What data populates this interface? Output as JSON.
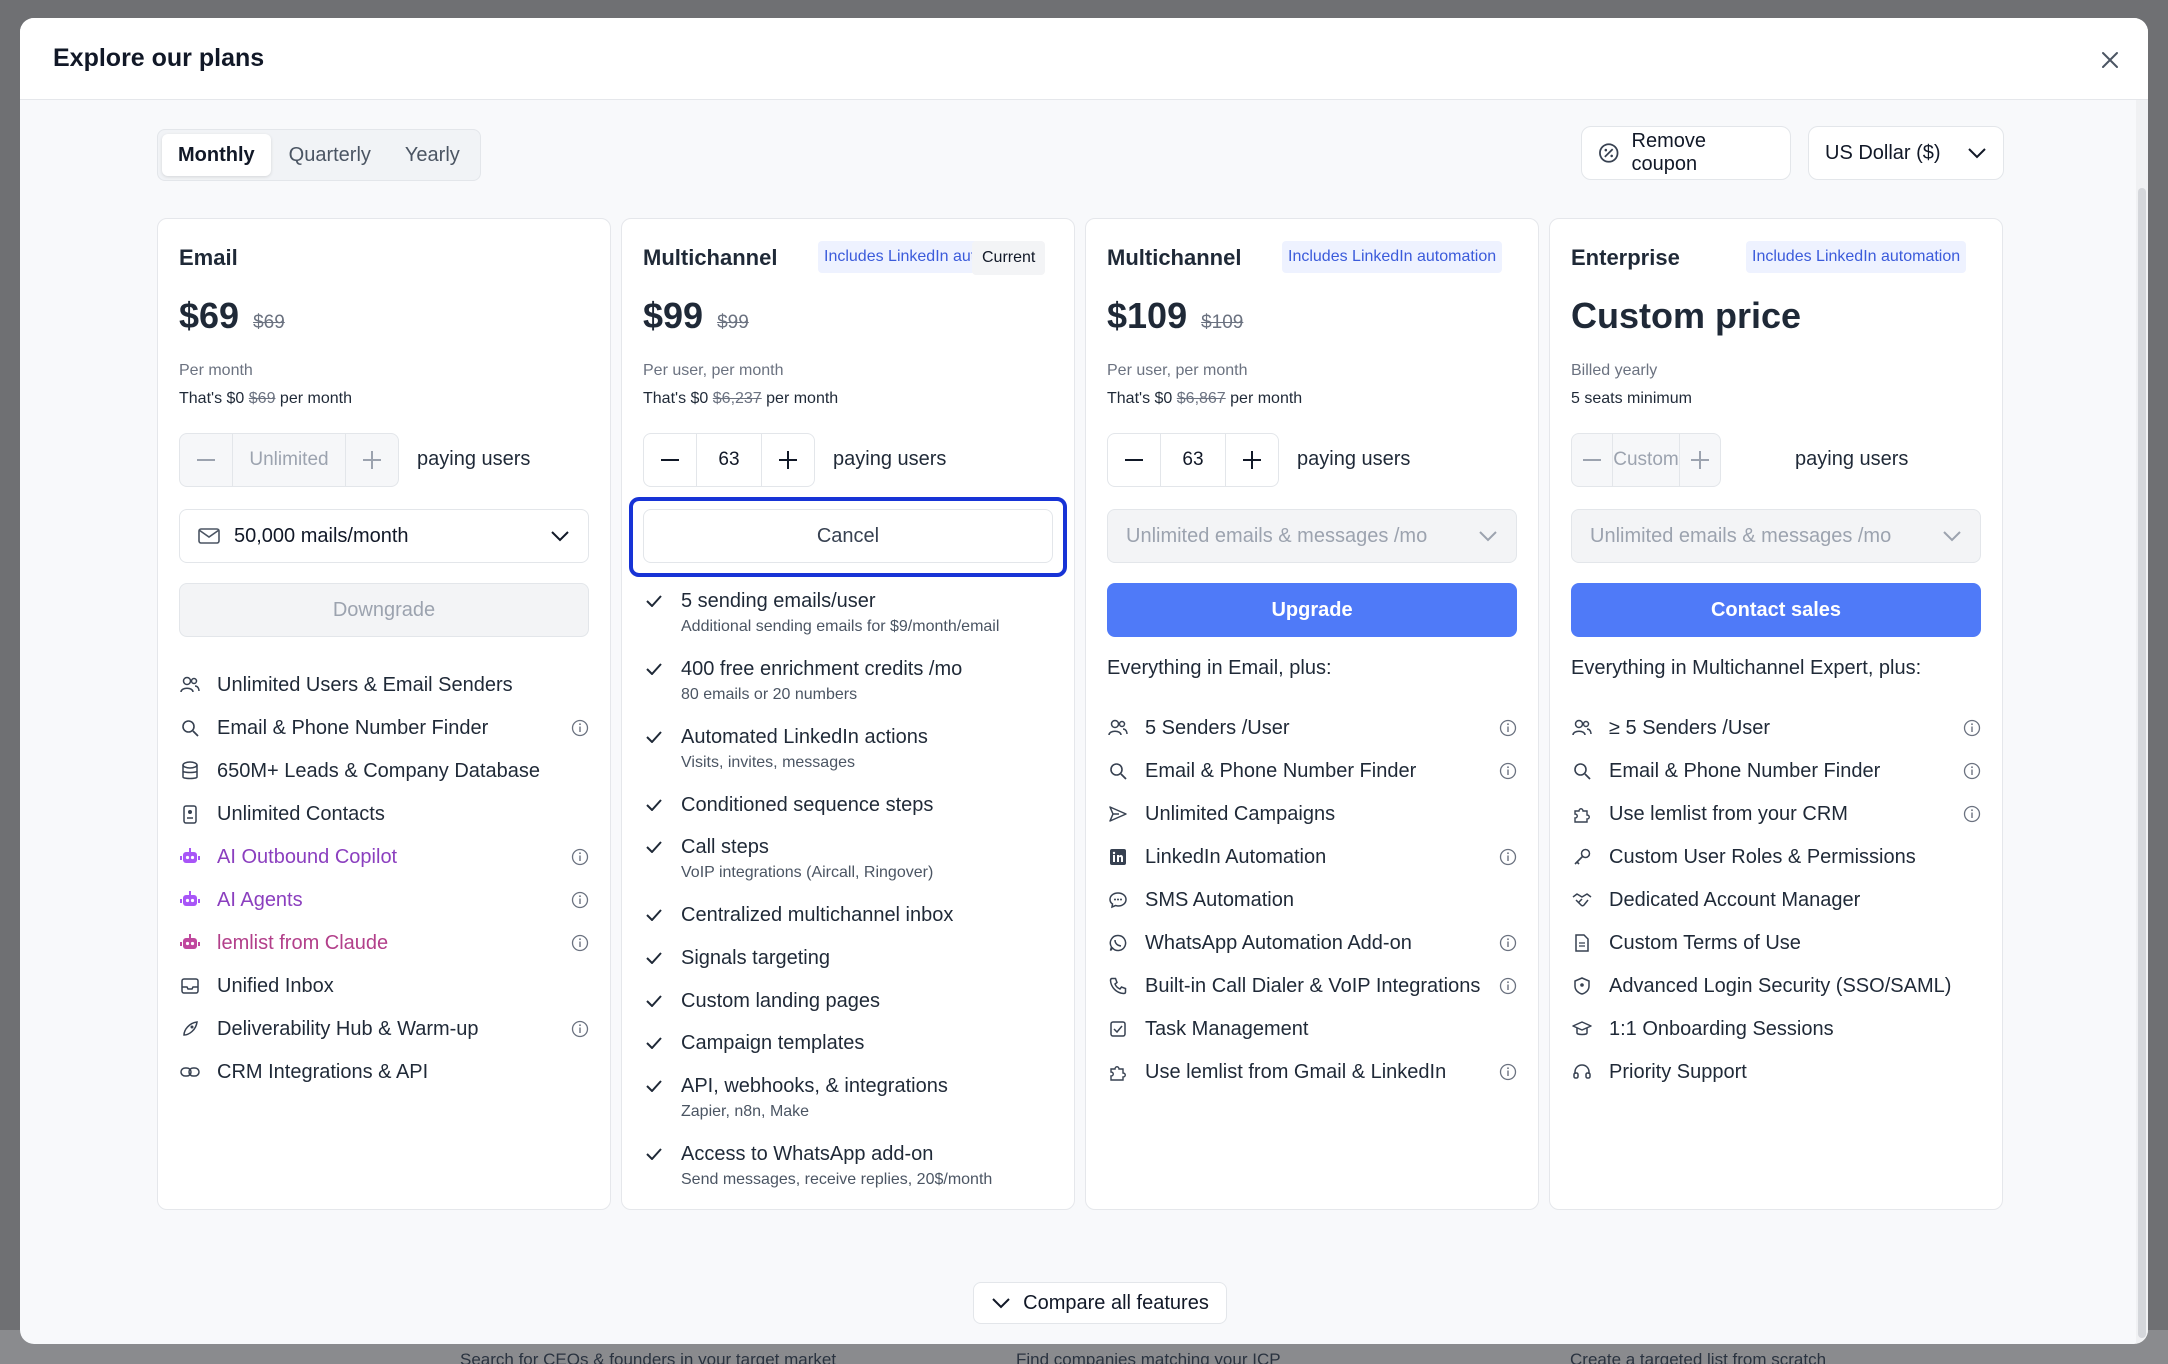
{
  "modal": {
    "title": "Explore our plans"
  },
  "period": {
    "options": [
      "Monthly",
      "Quarterly",
      "Yearly"
    ],
    "selected": "Monthly"
  },
  "coupon": {
    "label": "Remove coupon"
  },
  "currency": {
    "value": "US Dollar ($)"
  },
  "plans": [
    {
      "name": "Email",
      "price": "$69",
      "old_price": "$69",
      "sub1": "Per month",
      "sub2_prefix": "That's $0",
      "sub2_old": "$69",
      "sub2_suffix": "per month",
      "users": "Unlimited",
      "users_label": "paying users",
      "mails": "50,000 mails/month",
      "action": "Downgrade",
      "features": [
        {
          "icon": "users-icon",
          "label": "Unlimited Users & Email Senders",
          "info": false
        },
        {
          "icon": "search-icon",
          "label": "Email & Phone Number Finder",
          "info": true
        },
        {
          "icon": "database-icon",
          "label": "650M+ Leads & Company Database",
          "info": false
        },
        {
          "icon": "contact-icon",
          "label": "Unlimited Contacts",
          "info": false
        },
        {
          "icon": "ai-robot-icon",
          "label": "AI Outbound Copilot",
          "info": true
        },
        {
          "icon": "ai-robot-icon",
          "label": "AI Agents",
          "info": true
        },
        {
          "icon": "ai-robot-icon",
          "label": "lemlist from Claude",
          "info": true
        },
        {
          "icon": "inbox-icon",
          "label": "Unified Inbox",
          "info": false
        },
        {
          "icon": "rocket-icon",
          "label": "Deliverability Hub & Warm-up",
          "info": true
        },
        {
          "icon": "link-icon",
          "label": "CRM Integrations & API",
          "info": false
        }
      ]
    },
    {
      "name": "Multichannel",
      "badge": "Includes LinkedIn automation",
      "current": "Current",
      "price": "$99",
      "old_price": "$99",
      "sub1": "Per user, per month",
      "sub2_prefix": "That's $0",
      "sub2_old": "$6,237",
      "sub2_suffix": "per month",
      "users": "63",
      "users_label": "paying users",
      "action": "Cancel",
      "checks": [
        {
          "label": "5 sending emails/user",
          "desc": "Additional sending emails for $9/month/email"
        },
        {
          "label": "400 free enrichment credits /mo",
          "desc": "80 emails or 20 numbers"
        },
        {
          "label": "Automated LinkedIn actions",
          "desc": "Visits, invites, messages"
        },
        {
          "label": "Conditioned sequence steps",
          "desc": ""
        },
        {
          "label": "Call steps",
          "desc": "VoIP integrations (Aircall, Ringover)"
        },
        {
          "label": "Centralized multichannel inbox",
          "desc": ""
        },
        {
          "label": "Signals targeting",
          "desc": ""
        },
        {
          "label": "Custom landing pages",
          "desc": ""
        },
        {
          "label": "Campaign templates",
          "desc": ""
        },
        {
          "label": "API, webhooks, & integrations",
          "desc": "Zapier, n8n, Make"
        },
        {
          "label": "Access to WhatsApp add-on",
          "desc": "Send messages, receive replies, 20$/month"
        }
      ]
    },
    {
      "name": "Multichannel",
      "badge": "Includes LinkedIn automation",
      "price": "$109",
      "old_price": "$109",
      "sub1": "Per user, per month",
      "sub2_prefix": "That's $0",
      "sub2_old": "$6,867",
      "sub2_suffix": "per month",
      "users": "63",
      "users_label": "paying users",
      "mails": "Unlimited emails & messages /mo",
      "action": "Upgrade",
      "section_title": "Everything in Email, plus:",
      "features": [
        {
          "icon": "users-icon",
          "label": "5 Senders /User",
          "info": true
        },
        {
          "icon": "search-icon",
          "label": "Email & Phone Number Finder",
          "info": true
        },
        {
          "icon": "send-icon",
          "label": "Unlimited Campaigns",
          "info": false
        },
        {
          "icon": "linkedin-icon",
          "label": "LinkedIn Automation",
          "info": true
        },
        {
          "icon": "sms-icon",
          "label": "SMS Automation",
          "info": false
        },
        {
          "icon": "whatsapp-icon",
          "label": "WhatsApp Automation Add-on",
          "info": true
        },
        {
          "icon": "phone-icon",
          "label": "Built-in Call Dialer & VoIP Integrations",
          "info": true
        },
        {
          "icon": "task-icon",
          "label": "Task Management",
          "info": false
        },
        {
          "icon": "puzzle-icon",
          "label": "Use lemlist from Gmail & LinkedIn",
          "info": true
        }
      ]
    },
    {
      "name": "Enterprise",
      "badge": "Includes LinkedIn automation",
      "price": "Custom price",
      "sub1": "Billed yearly",
      "sub2": "5 seats minimum",
      "users": "Custom",
      "users_label": "paying users",
      "mails": "Unlimited emails & messages /mo",
      "action": "Contact sales",
      "section_title": "Everything in Multichannel Expert, plus:",
      "features": [
        {
          "icon": "users-icon",
          "label": "≥ 5 Senders /User",
          "info": true
        },
        {
          "icon": "search-icon",
          "label": "Email & Phone Number Finder",
          "info": true
        },
        {
          "icon": "puzzle-icon",
          "label": "Use lemlist from your CRM",
          "info": true
        },
        {
          "icon": "key-icon",
          "label": "Custom User Roles & Permissions",
          "info": false
        },
        {
          "icon": "handshake-icon",
          "label": "Dedicated Account Manager",
          "info": false
        },
        {
          "icon": "document-icon",
          "label": "Custom Terms of Use",
          "info": false
        },
        {
          "icon": "shield-icon",
          "label": "Advanced Login Security (SSO/SAML)",
          "info": false
        },
        {
          "icon": "graduation-icon",
          "label": "1:1 Onboarding Sessions",
          "info": false
        },
        {
          "icon": "headset-icon",
          "label": "Priority Support",
          "info": false
        }
      ]
    }
  ],
  "compare": {
    "label": "Compare all features"
  },
  "background": {
    "texts": [
      "Search for CEOs & founders in your target market",
      "Find companies matching your ICP",
      "Create a targeted list from scratch"
    ]
  },
  "colors": {
    "primary": "#4f7af8",
    "focus": "#1733d6",
    "badge_bg": "#eef2ff",
    "badge_text": "#3b5bdb"
  }
}
